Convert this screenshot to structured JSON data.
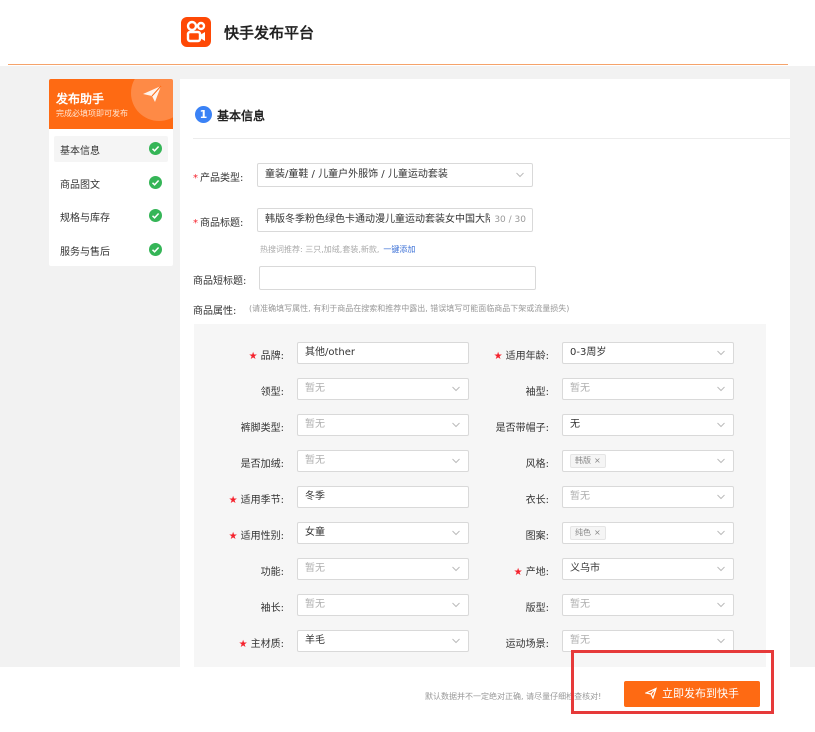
{
  "header": {
    "app_title": "快手发布平台",
    "logo_icon": "kuaishou-logo-icon"
  },
  "sidebar": {
    "title": "发布助手",
    "subtitle": "完成必填项即可发布",
    "items": [
      {
        "label": "基本信息",
        "active": true
      },
      {
        "label": "商品图文"
      },
      {
        "label": "规格与库存"
      },
      {
        "label": "服务与售后"
      }
    ]
  },
  "section": {
    "number": "1",
    "title": "基本信息"
  },
  "form": {
    "product_type": {
      "label": "产品类型:",
      "value": "童装/童鞋 / 儿童户外服饰 / 儿童运动套装"
    },
    "product_title": {
      "label": "商品标题:",
      "value": "韩版冬季粉色绿色卡通动漫儿童运动套装女中国大陆",
      "count": "30 / 30"
    },
    "hot_words": {
      "prefix": "热搜词推荐:",
      "words": "三只,加绒,套装,新款,",
      "link": "一键添加"
    },
    "short_title": {
      "label": "商品短标题:",
      "value": ""
    },
    "attributes": {
      "label": "商品属性:",
      "note": "(请准确填写属性, 有利于商品在搜索和推荐中露出, 错误填写可能面临商品下架或流量损失)"
    }
  },
  "attrs": {
    "brand": {
      "label": "品牌:",
      "value": "其他/other"
    },
    "age": {
      "label": "适用年龄:",
      "value": "0-3周岁"
    },
    "collar": {
      "label": "领型:",
      "value": "暂无"
    },
    "sleeve_type": {
      "label": "袖型:",
      "value": "暂无"
    },
    "hem": {
      "label": "裤脚类型:",
      "value": "暂无"
    },
    "hood": {
      "label": "是否带帽子:",
      "value": "无"
    },
    "velvet": {
      "label": "是否加绒:",
      "value": "暂无"
    },
    "style": {
      "label": "风格:",
      "tag": "韩版"
    },
    "season": {
      "label": "适用季节:",
      "value": "冬季"
    },
    "length": {
      "label": "衣长:",
      "value": "暂无"
    },
    "gender": {
      "label": "适用性别:",
      "value": "女童"
    },
    "pattern": {
      "label": "图案:",
      "tag": "纯色"
    },
    "function": {
      "label": "功能:",
      "value": "暂无"
    },
    "origin": {
      "label": "产地:",
      "value": "义乌市"
    },
    "sleeve_length": {
      "label": "袖长:",
      "value": "暂无"
    },
    "fit": {
      "label": "版型:",
      "value": "暂无"
    },
    "material": {
      "label": "主材质:",
      "value": "羊毛"
    },
    "sport": {
      "label": "运动场景:",
      "value": "暂无"
    }
  },
  "footer": {
    "note": "默认数据并不一定绝对正确, 请尽量仔细检查核对!",
    "publish_label": "立即发布到快手"
  },
  "colors": {
    "accent": "#fe6a13",
    "success": "#35b557",
    "link": "#3a6fd6",
    "highlight": "#e63a3a"
  }
}
